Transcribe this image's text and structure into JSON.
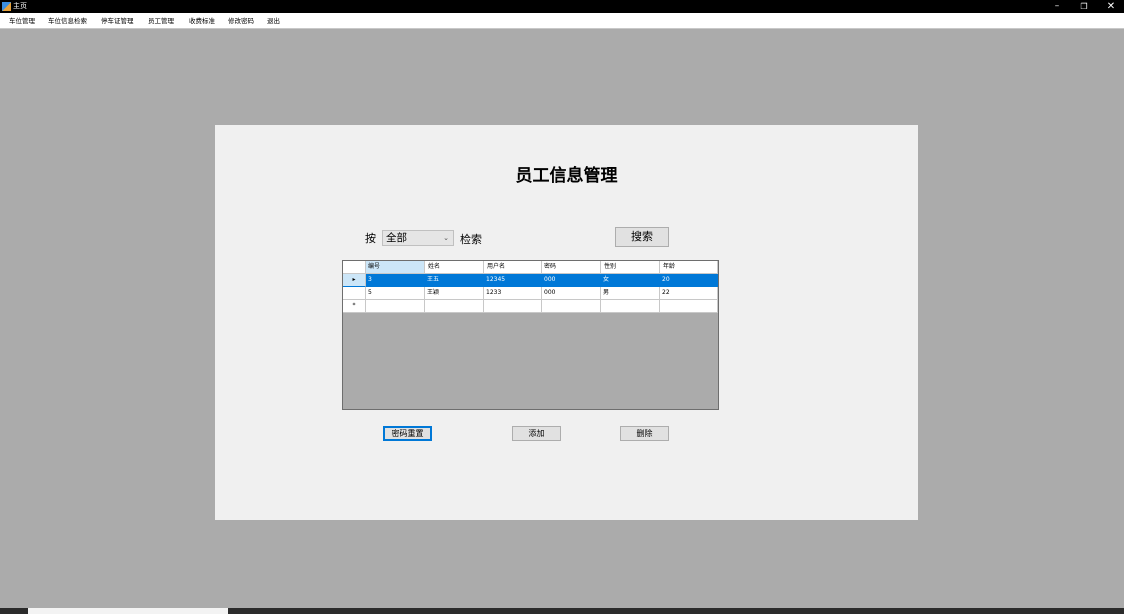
{
  "window": {
    "title": "主页",
    "controls": {
      "minimize": "–",
      "maximize": "❐",
      "close": "✕"
    }
  },
  "menu": [
    "车位管理",
    "车位信息检索",
    "停车证管理",
    "员工管理",
    "收费标准",
    "修改密码",
    "退出"
  ],
  "panel": {
    "title": "员工信息管理",
    "search": {
      "prefix": "按",
      "selected": "全部",
      "chevron": "⌄",
      "suffix": "检索",
      "button": "搜索"
    },
    "grid": {
      "columns": [
        "编号",
        "姓名",
        "用户名",
        "密码",
        "性别",
        "年龄"
      ],
      "rows": [
        [
          "3",
          "王五",
          "12345",
          "000",
          "女",
          "20"
        ],
        [
          "5",
          "王颖",
          "1233",
          "000",
          "男",
          "22"
        ]
      ],
      "row_markers": {
        "current": "▸",
        "new": "*"
      }
    },
    "buttons": {
      "reset_password": "密码重置",
      "add": "添加",
      "delete": "删除"
    }
  },
  "colors": {
    "selection": "#0078d7",
    "background": "#ababab",
    "panel": "#f0f0f0"
  },
  "icons": {
    "app": "app-icon",
    "dropdown": "chevron-down-icon"
  }
}
